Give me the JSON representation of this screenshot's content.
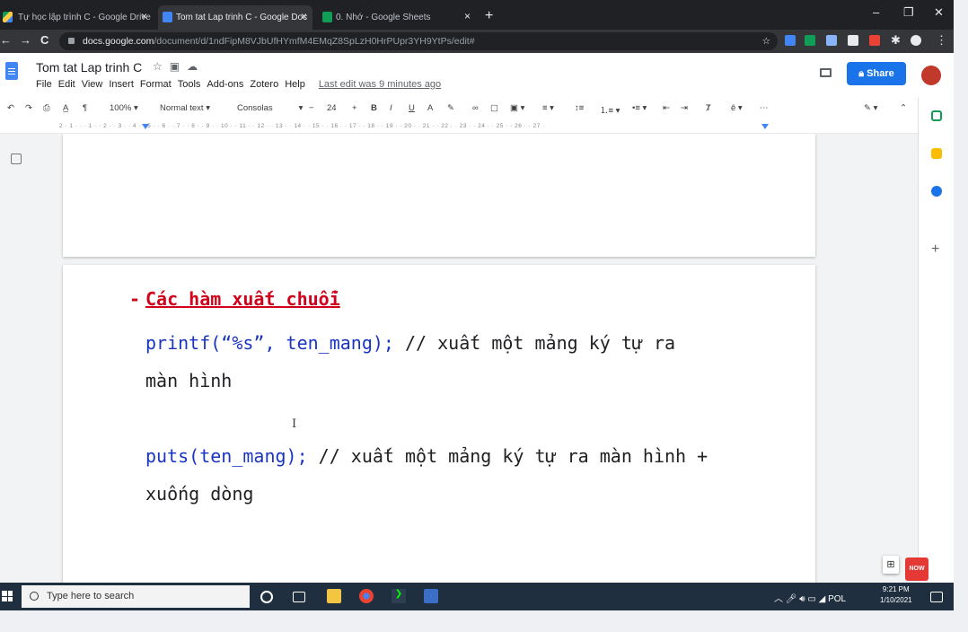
{
  "browser": {
    "tabs": [
      {
        "label": "Tự học lập trình C - Google Drive",
        "icon": "google-drive-icon",
        "active": false
      },
      {
        "label": "Tom tat Lap trinh C - Google Doc",
        "icon": "google-docs-icon",
        "active": true
      },
      {
        "label": "0. Nhớ - Google Sheets",
        "icon": "google-sheets-icon",
        "active": false
      }
    ],
    "url_host": "docs.google.com",
    "url_path": "/document/d/1ndFipM8VJbUfHYmfM4EMqZ8SpLzH0HrPUpr3YH9YtPs/edit#"
  },
  "docs": {
    "title": "Tom tat Lap trinh C",
    "menu": [
      "File",
      "Edit",
      "View",
      "Insert",
      "Format",
      "Tools",
      "Add-ons",
      "Zotero",
      "Help"
    ],
    "last_edit": "Last edit was 9 minutes ago",
    "share_label": "Share",
    "toolbar": {
      "zoom": "100%",
      "style": "Normal text",
      "font": "Consolas",
      "font_size": "24"
    },
    "ruler_numbers": "2 · 1 · · · 1 · · 2 · · 3 · · 4 · · 5 · · 6 · · 7 · · 8 · · 9 · · 10 · · 11 · · 12 · · 13 · · 14 · · 15 · · 16 · · 17 · · 18 · · 19 · · 20 · · 21 · · 22 · · 23 · · 24 · · 25 · · 26 · · 27 ·"
  },
  "content": {
    "bullet": "-",
    "heading": "Các hàm xuất chuỗi",
    "line1_code": "printf(“%s”, ten_mang);",
    "line1_comment": " // xuất một mảng ký tự ra",
    "line1_cont": "màn hình",
    "line2_code": "puts(ten_mang);",
    "line2_comment": " // xuất một mảng ký tự ra màn hình +",
    "line2_cont": "xuống dòng"
  },
  "taskbar": {
    "search_placeholder": "Type here to search",
    "lang": "POL",
    "time": "9:21 PM",
    "date": "1/10/2021"
  },
  "badge": {
    "text": "NOW"
  },
  "colors": {
    "heading_red": "#d0021b",
    "code_blue": "#1a35c2",
    "share_blue": "#1a73e8"
  }
}
